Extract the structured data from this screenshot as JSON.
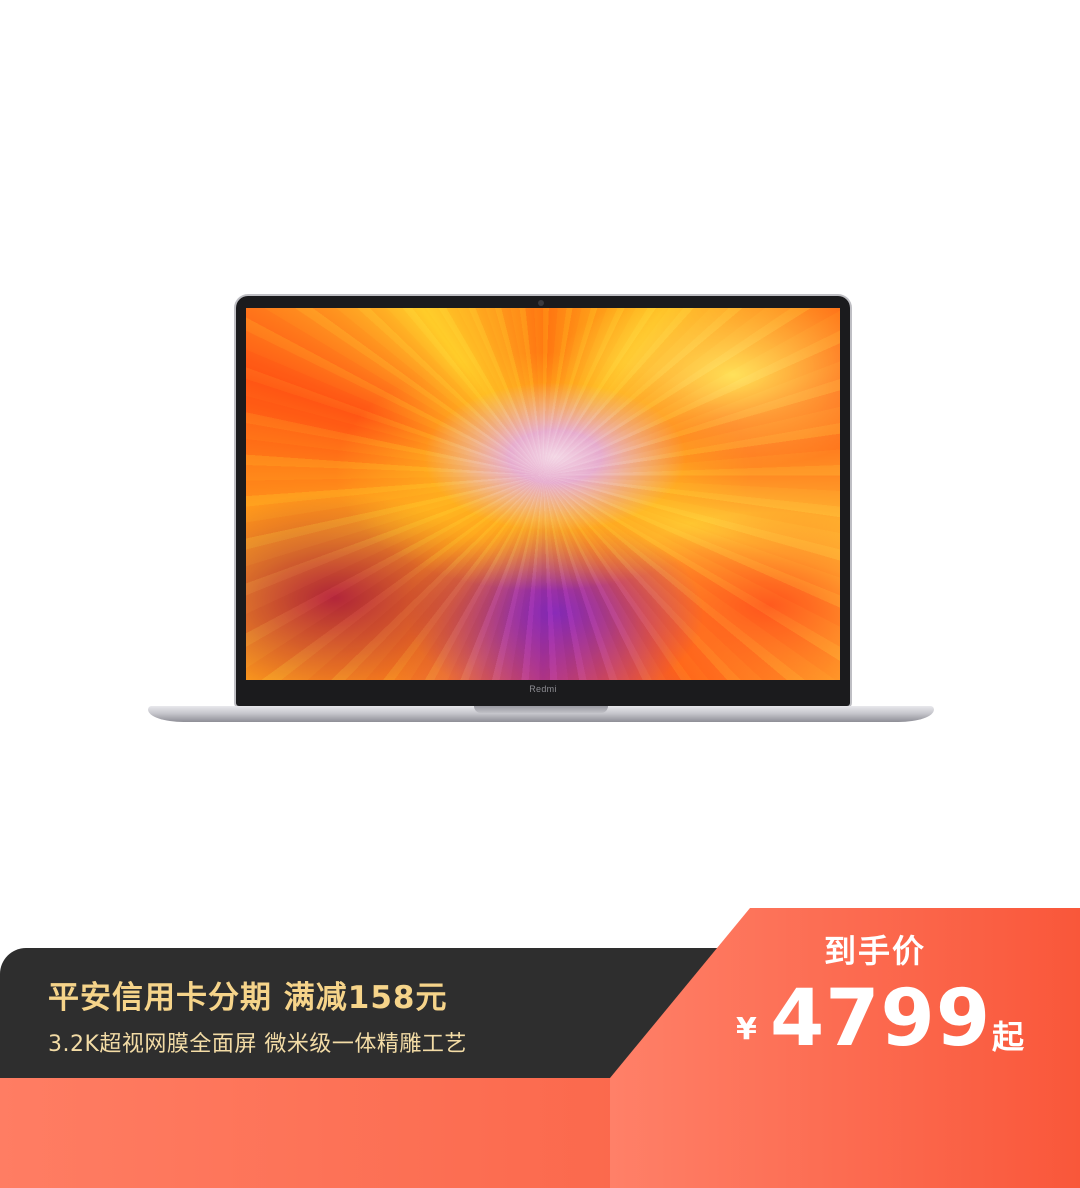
{
  "product": {
    "brand_label": "Redmi"
  },
  "promo": {
    "headline": "平安信用卡分期 满减158元",
    "subline": "3.2K超视网膜全面屏 微米级一体精雕工艺"
  },
  "price": {
    "label": "到手价",
    "currency": "¥",
    "amount": "4799",
    "suffix": "起"
  },
  "colors": {
    "banner_dark": "#2e2e2e",
    "banner_orange": "#f85a3c",
    "headline_gold": "#f6d48a",
    "price_text": "#ffffff"
  }
}
